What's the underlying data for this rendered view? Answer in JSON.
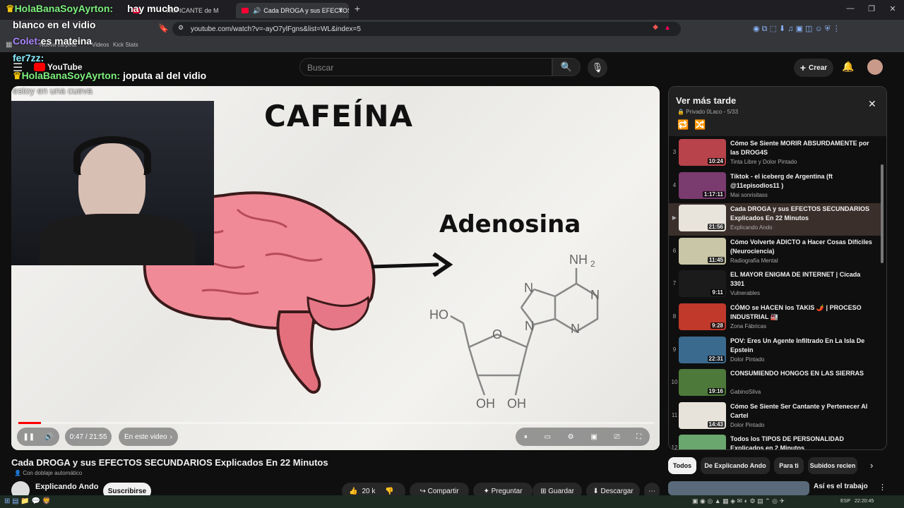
{
  "browser": {
    "tabs": [
      {
        "label": "TRIFICANTE de M"
      },
      {
        "label": "Cada DROGA y sus EFECTOS"
      }
    ],
    "url": "youtube.com/watch?v=-ayO7ylFgns&list=WL&index=5",
    "bookmarks": [
      "Nueva carpeta",
      "Videos",
      "Kick Stats"
    ]
  },
  "youtube": {
    "logo": "YouTube",
    "search_placeholder": "Buscar",
    "create_label": "Crear"
  },
  "video": {
    "title": "Cada DROGA y sus EFECTOS SECUNDARIOS Explicados En 22 Minutos",
    "dubbing": "Con doblaje automático",
    "channel": "Explicando Ando",
    "subscribe": "Suscribirse",
    "time": "0:47 / 21:55",
    "progress": 0.036,
    "in_video": "En este video",
    "content": {
      "word1": "CAFEÍNA",
      "word2": "Adenosina",
      "nh2": "NH",
      "nh2_sub": "2",
      "ho": "HO",
      "oh1": "OH",
      "oh2": "OH",
      "o": "O",
      "n1": "N",
      "n2": "N",
      "n3": "N",
      "n4": "N"
    },
    "actions": {
      "likes": "20 k",
      "share": "Compartir",
      "ask": "Preguntar",
      "save": "Guardar",
      "download": "Descargar"
    }
  },
  "chat_overlay": [
    {
      "user": "HolaBanaSoyAyrton:",
      "text": "hay mucho"
    },
    {
      "user": "",
      "text": "blanco en el vidio"
    },
    {
      "user": "Colet:",
      "text": "es mateina"
    },
    {
      "user": "fer7zz:",
      "text": ""
    },
    {
      "user": "HolaBanaSoyAyrton:",
      "text": "joputa al del vidio"
    },
    {
      "user": "",
      "text": "estoy en una cueva"
    }
  ],
  "playlist": {
    "title": "Ver más tarde",
    "meta": "Privado 0Laco - 5/33",
    "items": [
      {
        "num": "3",
        "title": "Cómo Se Siente MORIR ABSURDAMENTE por las DROG4S",
        "channel": "Tinta Libre y Dolor Pintado",
        "duration": "10:24",
        "color": "#b8434a"
      },
      {
        "num": "4",
        "title": "Tiktok - el iceberg de Argentina (ft @11episodios11 )",
        "channel": "Mai sonrisitass",
        "duration": "1:17:11",
        "color": "#7a3b6e"
      },
      {
        "num": "▶",
        "title": "Cada DROGA y sus EFECTOS SECUNDARIOS Explicados En 22 Minutos",
        "channel": "Explicando Ando",
        "duration": "21:56",
        "color": "#e8e4dc"
      },
      {
        "num": "6",
        "title": "Cómo Volverte ADICTO a Hacer Cosas Difíciles (Neurociencia)",
        "channel": "Radiografía Mental",
        "duration": "11:45",
        "color": "#c9c6a8"
      },
      {
        "num": "7",
        "title": "EL MAYOR ENIGMA DE INTERNET | Cicada 3301",
        "channel": "Vulnerables",
        "duration": "9:11",
        "color": "#1b1b1b"
      },
      {
        "num": "8",
        "title": "CÓMO se HACEN los TAKIS 🌶️ | PROCESO INDUSTRIAL 🏭",
        "channel": "Zona Fábricas",
        "duration": "9:28",
        "color": "#c0392b"
      },
      {
        "num": "9",
        "title": "POV: Eres Un Agente Infiltrado En La Isla De Epstein",
        "channel": "Dolor Pintado",
        "duration": "22:31",
        "color": "#3b6a8f"
      },
      {
        "num": "10",
        "title": "CONSUMIENDO HONGOS EN LAS SIERRAS",
        "channel": "GabinoSilva",
        "duration": "19:16",
        "color": "#4d7a3a"
      },
      {
        "num": "11",
        "title": "Cómo Se Siente Ser Cantante y Pertenecer Al Cartel",
        "channel": "Dolor Pintado",
        "duration": "14:43",
        "color": "#e7e2da"
      },
      {
        "num": "12",
        "title": "Todos los TIPOS DE PERSONALIDAD Explicados en 2 Minutos",
        "channel": "",
        "duration": "",
        "color": "#6aa76e"
      }
    ]
  },
  "chips": [
    "Todos",
    "De Explicando Ando",
    "Para ti",
    "Subidos recien"
  ],
  "recommended": {
    "title": "Así es el trabajo"
  },
  "taskbar": {
    "lang": "ESP",
    "clock": "22:20:45"
  }
}
